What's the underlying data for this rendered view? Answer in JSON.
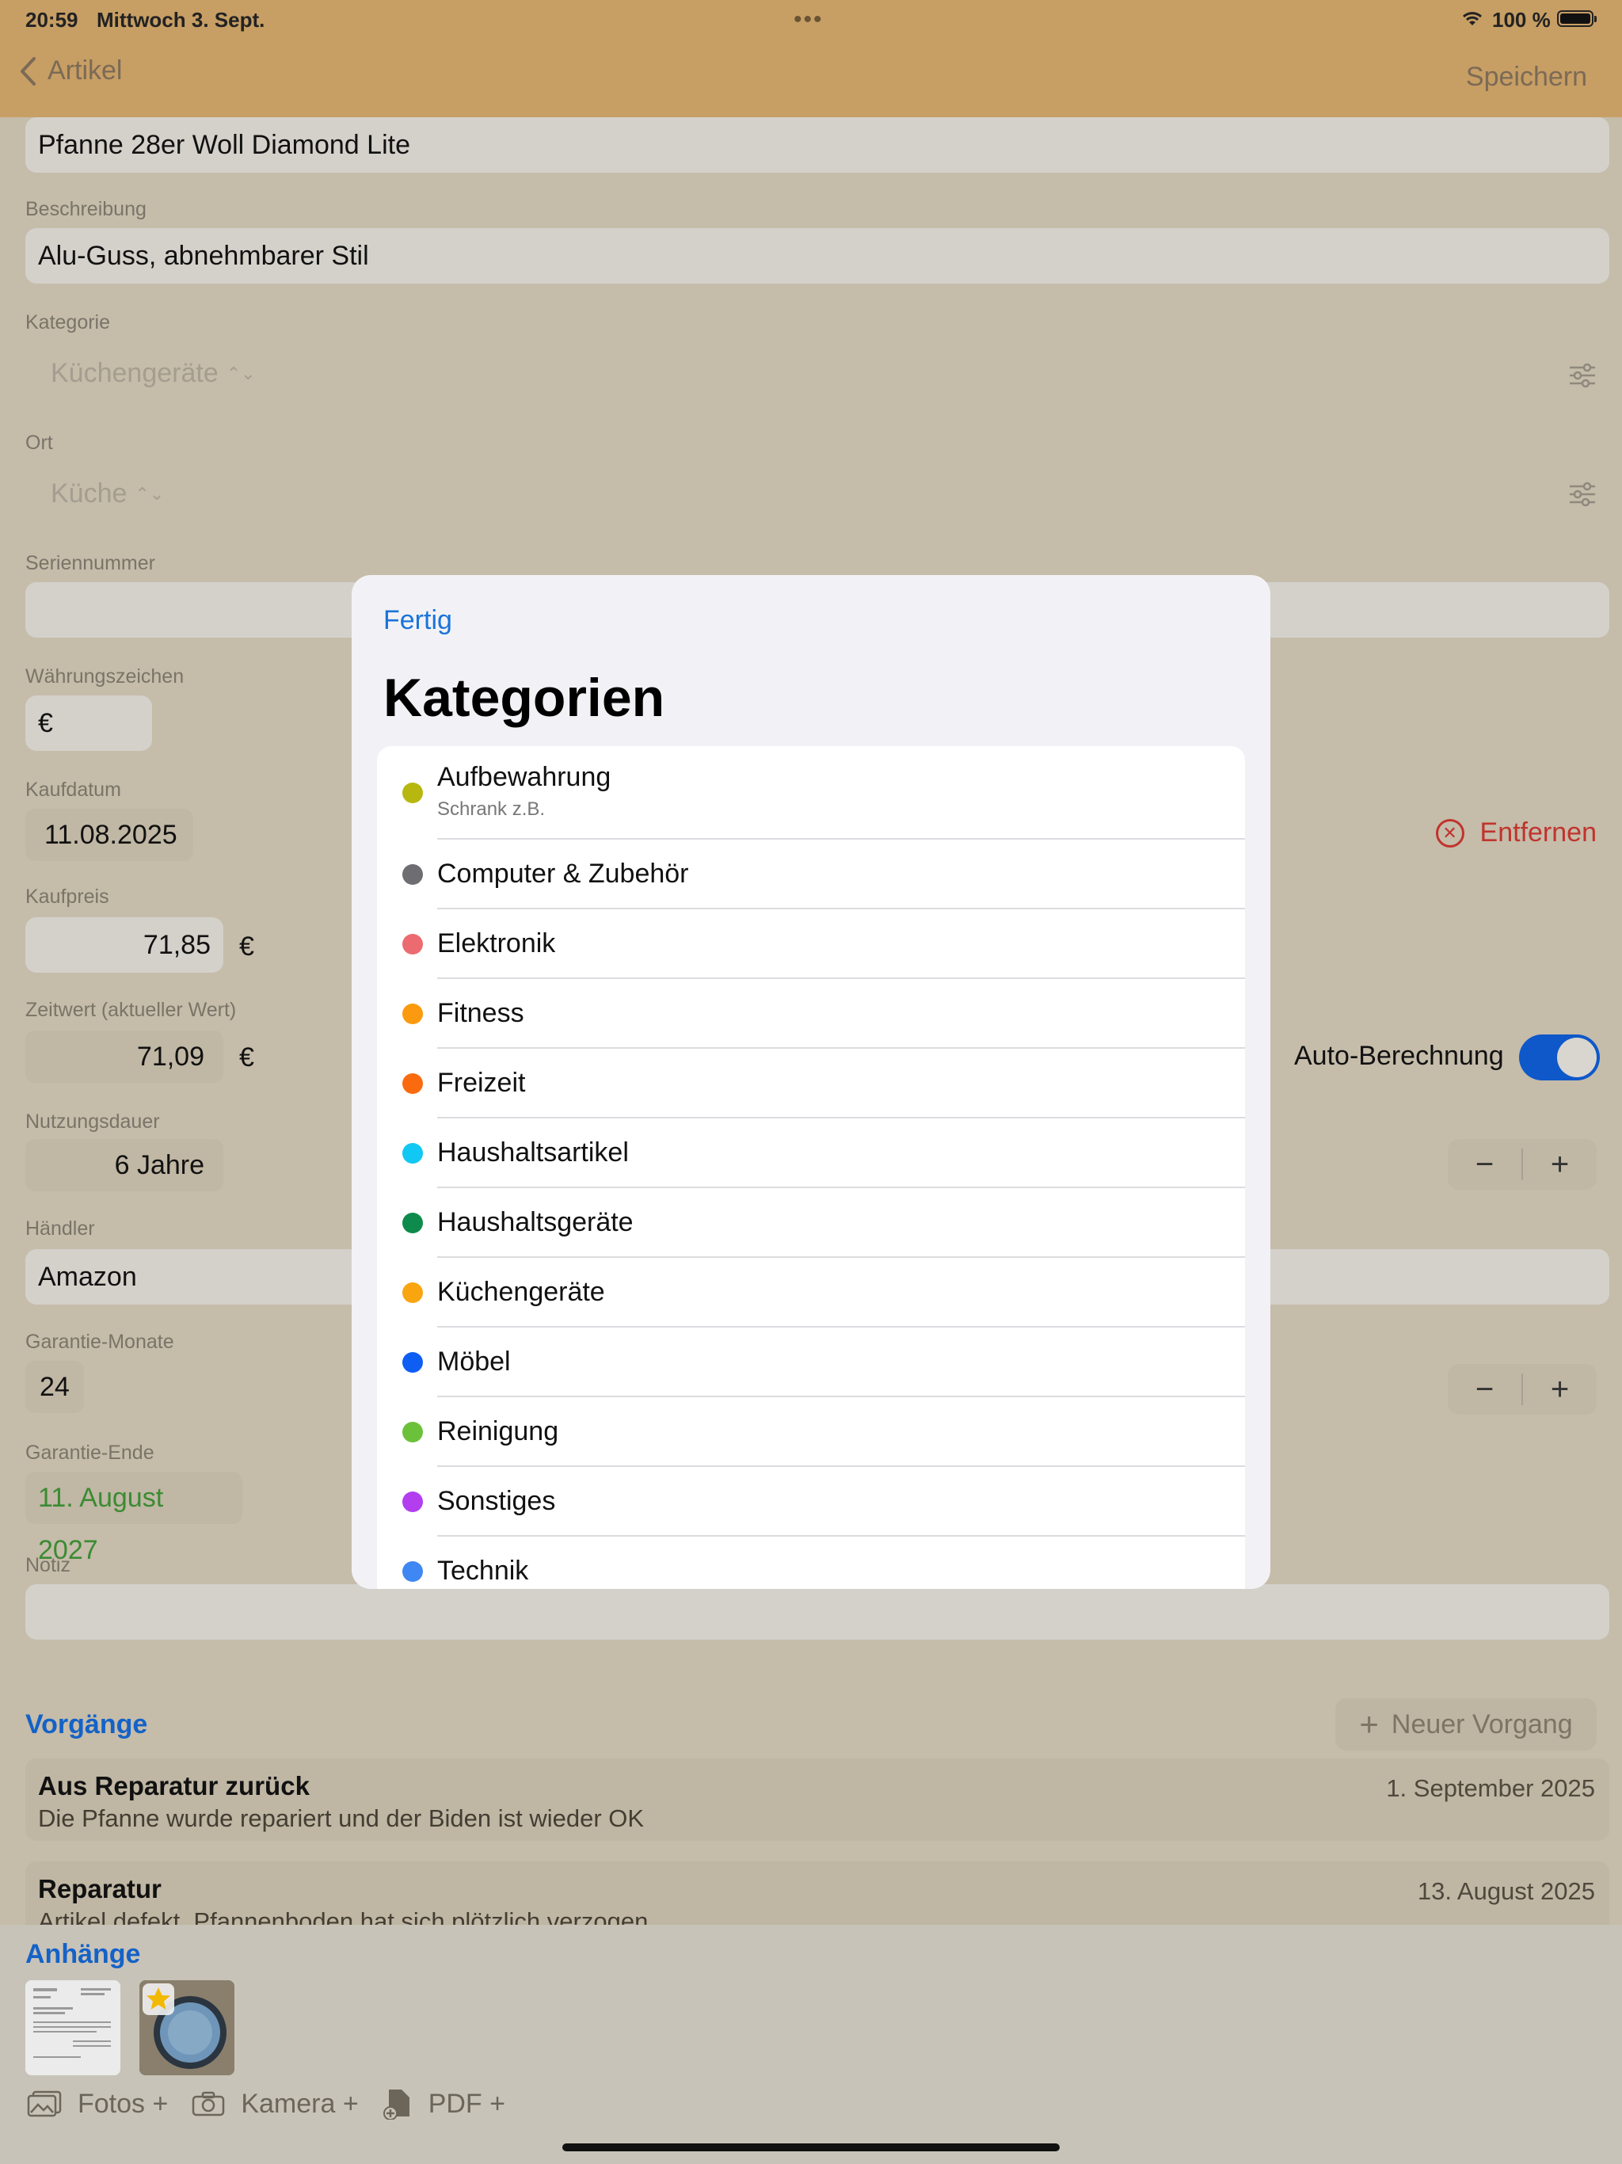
{
  "status": {
    "time": "20:59",
    "date": "Mittwoch 3. Sept.",
    "battery": "100 %"
  },
  "nav": {
    "back_label": "Artikel",
    "save_label": "Speichern"
  },
  "form": {
    "name_value": "Pfanne 28er Woll Diamond Lite",
    "description": {
      "label": "Beschreibung",
      "value": "Alu-Guss, abnehmbarer Stil"
    },
    "category": {
      "label": "Kategorie",
      "value": "Küchengeräte"
    },
    "location": {
      "label": "Ort",
      "value": "Küche"
    },
    "serial": {
      "label": "Seriennummer",
      "value": ""
    },
    "currency": {
      "label": "Währungszeichen",
      "value": "€"
    },
    "purchase_date": {
      "label": "Kaufdatum",
      "value": "11.08.2025",
      "remove_label": "Entfernen"
    },
    "price": {
      "label": "Kaufpreis",
      "value": "71,85",
      "unit": "€"
    },
    "current_value": {
      "label": "Zeitwert (aktueller Wert)",
      "value": "71,09",
      "unit": "€",
      "auto_label": "Auto-Berechnung",
      "auto_on": true
    },
    "lifetime": {
      "label": "Nutzungsdauer",
      "value": "6 Jahre",
      "minus": "−",
      "plus": "+"
    },
    "dealer": {
      "label": "Händler",
      "value": "Amazon"
    },
    "warranty_months": {
      "label": "Garantie-Monate",
      "value": "24",
      "minus": "−",
      "plus": "+"
    },
    "warranty_end": {
      "label": "Garantie-Ende",
      "value": "11. August 2027",
      "color": "#3b8b32"
    },
    "note": {
      "label": "Notiz",
      "value": ""
    }
  },
  "events": {
    "title": "Vorgänge",
    "new_label": "Neuer Vorgang",
    "items": [
      {
        "title": "Aus Reparatur zurück",
        "date": "1. September 2025",
        "desc": "Die Pfanne wurde repariert und der Biden ist wieder OK"
      },
      {
        "title": "Reparatur",
        "date": "13. August 2025",
        "desc": "Artikel defekt, Pfannenboden hat sich plötzlich verzogen"
      }
    ]
  },
  "attachments": {
    "title": "Anhänge",
    "photos_label": "Fotos +",
    "camera_label": "Kamera +",
    "pdf_label": "PDF +"
  },
  "modal": {
    "done_label": "Fertig",
    "title": "Kategorien",
    "categories": [
      {
        "name": "Aufbewahrung",
        "sub": "Schrank z.B.",
        "color": "#b7b70f"
      },
      {
        "name": "Computer & Zubehör",
        "color": "#6d6d72"
      },
      {
        "name": "Elektronik",
        "color": "#ec6b70"
      },
      {
        "name": "Fitness",
        "color": "#fb9a0e"
      },
      {
        "name": "Freizeit",
        "color": "#fa6b10"
      },
      {
        "name": "Haushaltsartikel",
        "color": "#10c8f3"
      },
      {
        "name": "Haushaltsgeräte",
        "color": "#0e8b4c"
      },
      {
        "name": "Küchengeräte",
        "color": "#f9a50f"
      },
      {
        "name": "Möbel",
        "color": "#0e5ef4"
      },
      {
        "name": "Reinigung",
        "color": "#6cc13b"
      },
      {
        "name": "Sonstiges",
        "color": "#b23ef0"
      },
      {
        "name": "Technik",
        "color": "#3f87f2"
      }
    ]
  }
}
